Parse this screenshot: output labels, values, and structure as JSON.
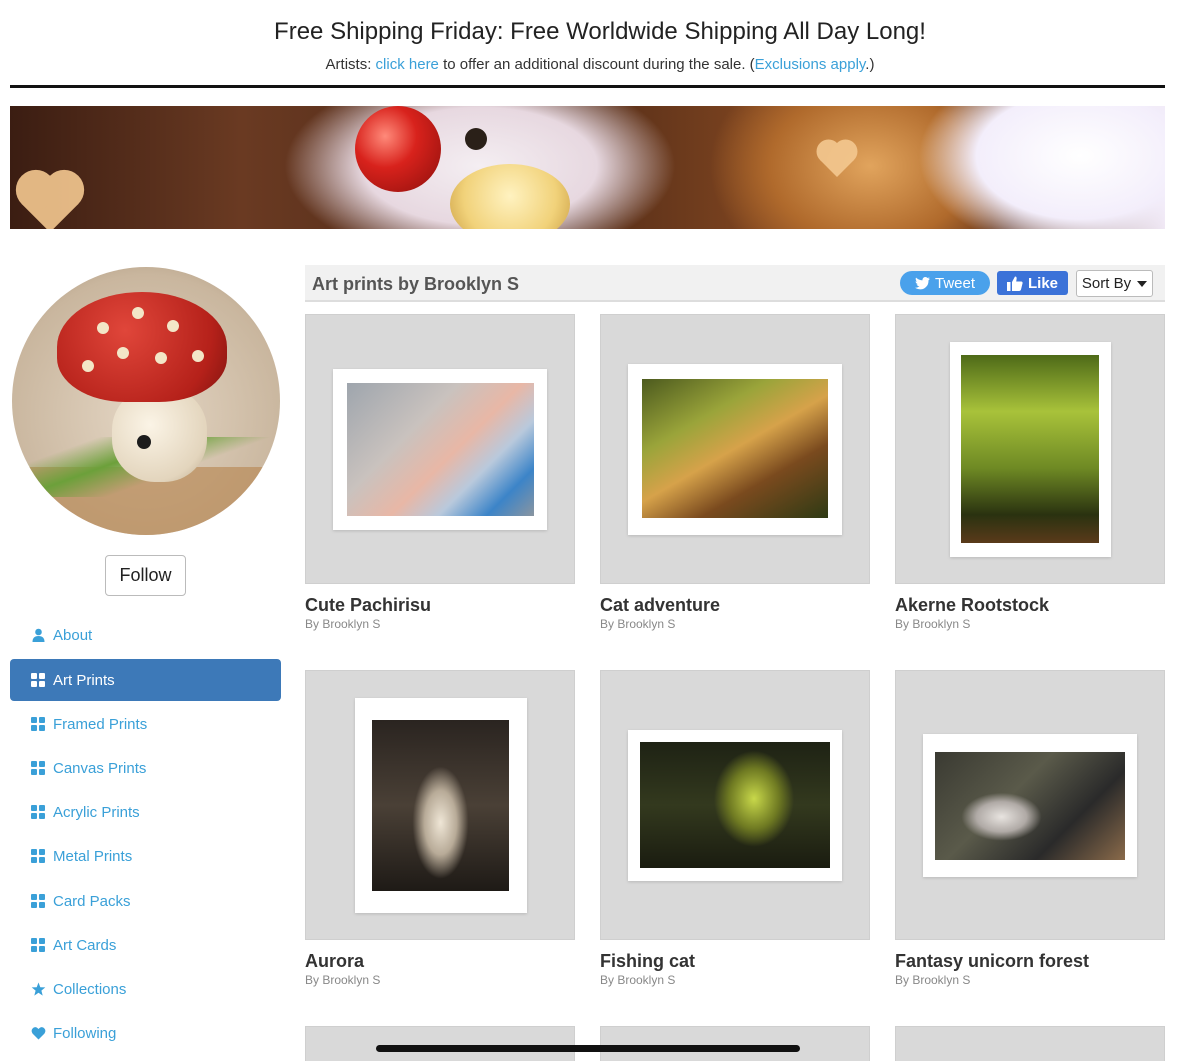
{
  "promo": {
    "title": "Free Shipping Friday: Free Worldwide Shipping All Day Long!",
    "sub_prefix": "Artists: ",
    "sub_link": "click here",
    "sub_middle": " to offer an additional discount during the sale. (",
    "sub_link2": "Exclusions apply",
    "sub_suffix": ".)"
  },
  "sidebar": {
    "follow_label": "Follow",
    "items": [
      {
        "label": "About",
        "icon": "user-icon"
      },
      {
        "label": "Art Prints",
        "icon": "grid-icon",
        "active": true
      },
      {
        "label": "Framed Prints",
        "icon": "grid-icon"
      },
      {
        "label": "Canvas Prints",
        "icon": "grid-icon"
      },
      {
        "label": "Acrylic Prints",
        "icon": "grid-icon"
      },
      {
        "label": "Metal Prints",
        "icon": "grid-icon"
      },
      {
        "label": "Card Packs",
        "icon": "grid-icon"
      },
      {
        "label": "Art Cards",
        "icon": "grid-icon"
      },
      {
        "label": "Collections",
        "icon": "star-icon"
      },
      {
        "label": "Following",
        "icon": "heart-icon"
      }
    ]
  },
  "header": {
    "title": "Art prints by Brooklyn S",
    "tweet_label": "Tweet",
    "like_label": "Like",
    "sort_label": "Sort By"
  },
  "products": [
    {
      "title": "Cute Pachirisu",
      "by": "By Brooklyn S"
    },
    {
      "title": "Cat adventure",
      "by": "By Brooklyn S"
    },
    {
      "title": "Akerne Rootstock",
      "by": "By Brooklyn S"
    },
    {
      "title": "Aurora",
      "by": "By Brooklyn S"
    },
    {
      "title": "Fishing cat",
      "by": "By Brooklyn S"
    },
    {
      "title": "Fantasy unicorn forest",
      "by": "By Brooklyn S"
    }
  ],
  "colors": {
    "link": "#3aa0d8",
    "active_nav": "#3d79b8",
    "tweet": "#4aa1eb",
    "like": "#3b72d8"
  }
}
